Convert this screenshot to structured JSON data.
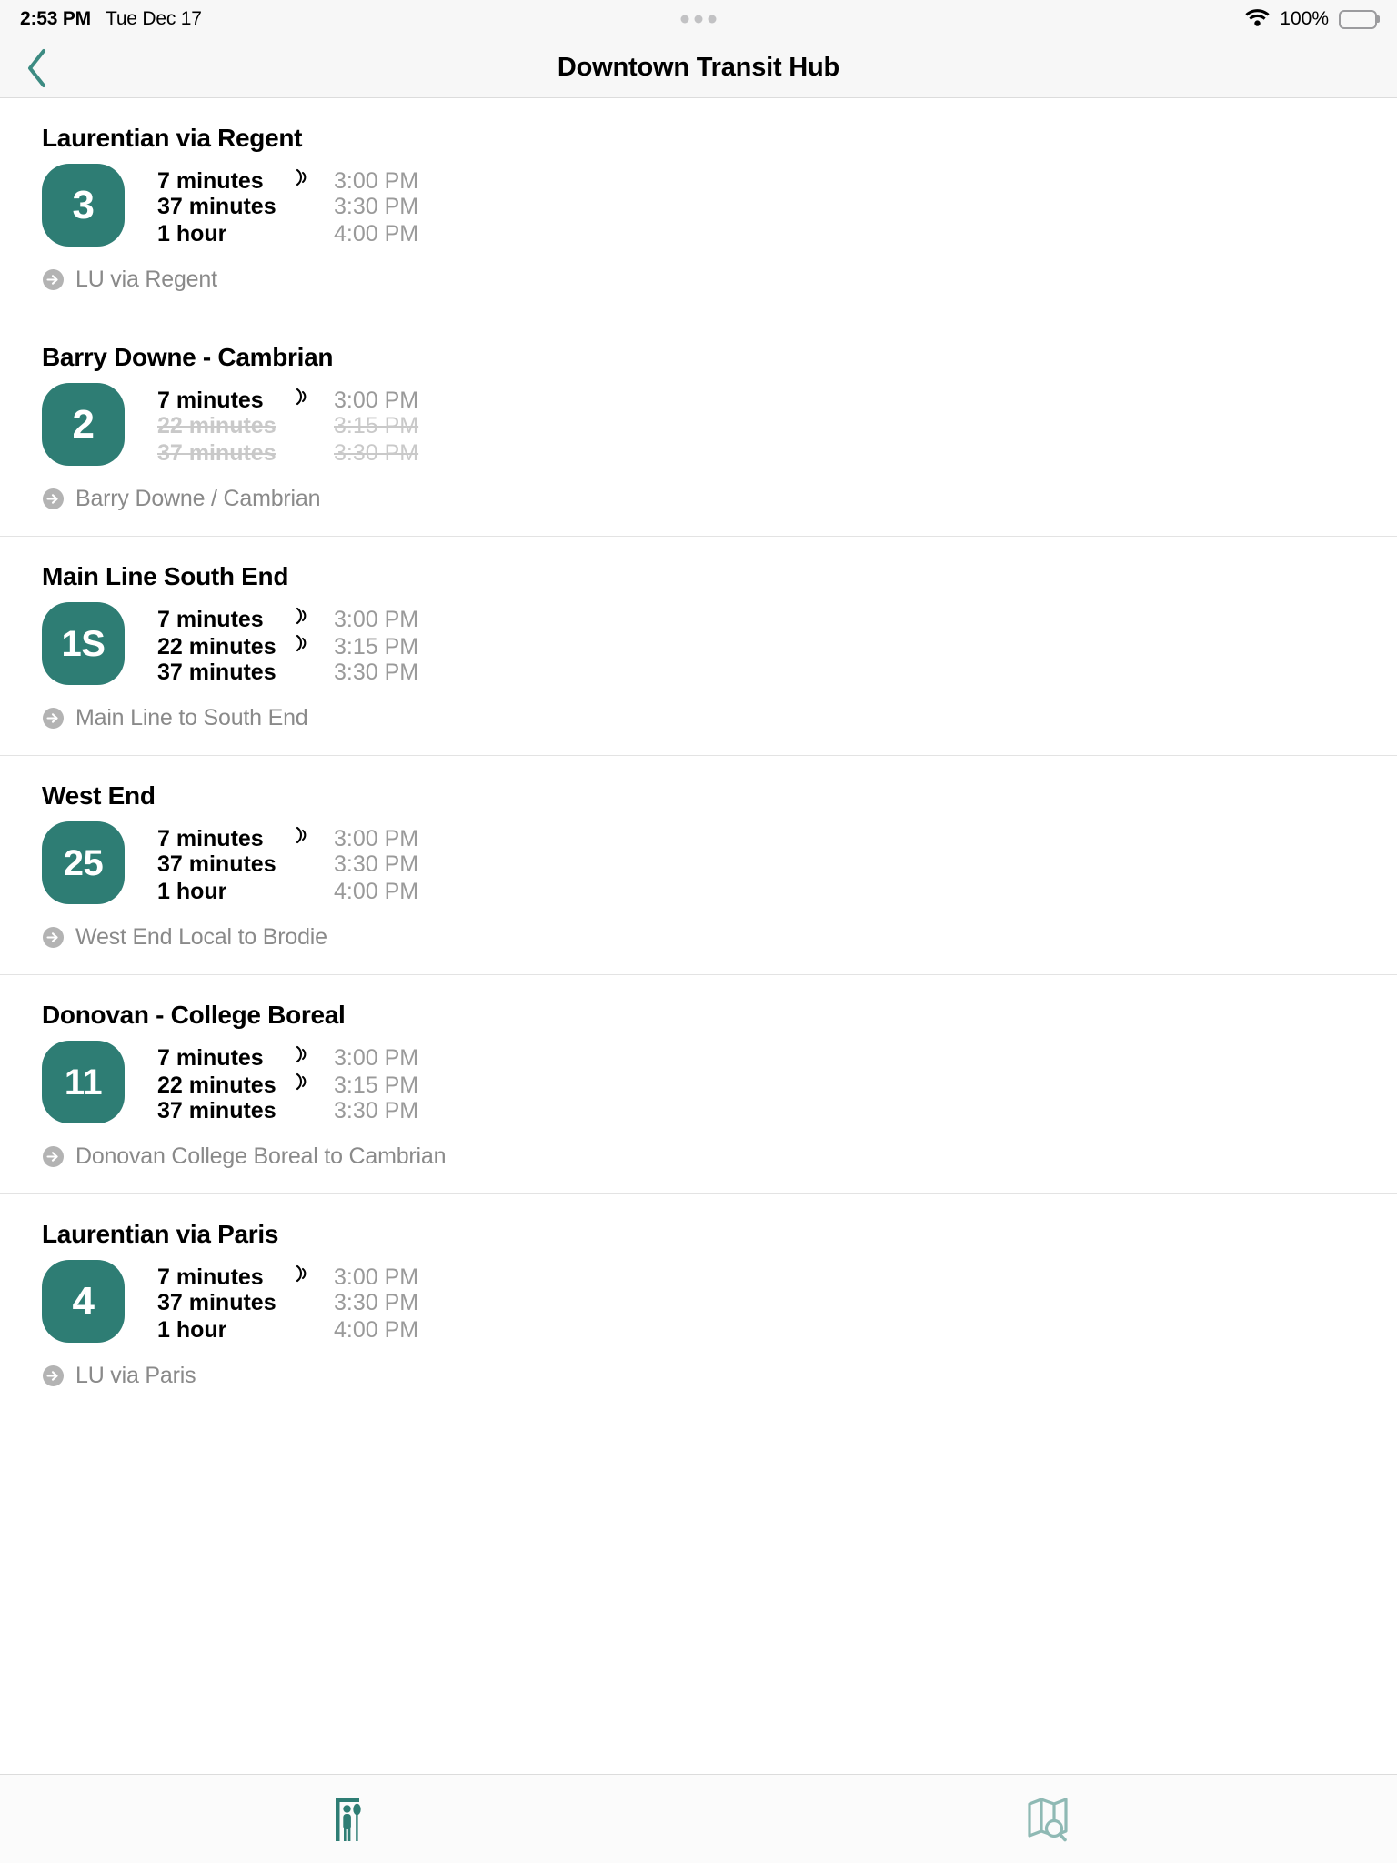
{
  "statusbar": {
    "time": "2:53 PM",
    "date": "Tue Dec 17",
    "battery_percent": "100%",
    "wifi_icon": "wifi-icon",
    "battery_icon": "battery-full-icon",
    "center_indicator": "three-dots-indicator"
  },
  "navbar": {
    "title": "Downtown Transit Hub",
    "back_icon": "chevron-left-icon"
  },
  "theme": {
    "accent": "#2e7d74",
    "accent_inactive": "#8fb9b4",
    "muted_text": "#9a9a9a",
    "cancelled_text": "#c9c9c9",
    "divider": "#e3e3e3",
    "chrome_bg": "#f7f7f7"
  },
  "routes": [
    {
      "name": "Laurentian via Regent",
      "badge": "3",
      "destination": "LU via Regent",
      "destination_icon": "arrow-right-circle-icon",
      "departures": [
        {
          "minutes": "7 minutes",
          "clock": "3:00 PM",
          "live": true,
          "cancelled": false
        },
        {
          "minutes": "37 minutes",
          "clock": "3:30 PM",
          "live": false,
          "cancelled": false
        },
        {
          "minutes": "1 hour",
          "clock": "4:00 PM",
          "live": false,
          "cancelled": false
        }
      ]
    },
    {
      "name": "Barry Downe - Cambrian",
      "badge": "2",
      "destination": "Barry Downe / Cambrian",
      "destination_icon": "arrow-right-circle-icon",
      "departures": [
        {
          "minutes": "7 minutes",
          "clock": "3:00 PM",
          "live": true,
          "cancelled": false
        },
        {
          "minutes": "22 minutes",
          "clock": "3:15 PM",
          "live": false,
          "cancelled": true
        },
        {
          "minutes": "37 minutes",
          "clock": "3:30 PM",
          "live": false,
          "cancelled": true
        }
      ]
    },
    {
      "name": "Main Line South End",
      "badge": "1S",
      "destination": "Main Line to South End",
      "destination_icon": "arrow-right-circle-icon",
      "departures": [
        {
          "minutes": "7 minutes",
          "clock": "3:00 PM",
          "live": true,
          "cancelled": false
        },
        {
          "minutes": "22 minutes",
          "clock": "3:15 PM",
          "live": true,
          "cancelled": false
        },
        {
          "minutes": "37 minutes",
          "clock": "3:30 PM",
          "live": false,
          "cancelled": false
        }
      ]
    },
    {
      "name": "West End",
      "badge": "25",
      "destination": "West End Local to Brodie",
      "destination_icon": "arrow-right-circle-icon",
      "departures": [
        {
          "minutes": "7 minutes",
          "clock": "3:00 PM",
          "live": true,
          "cancelled": false
        },
        {
          "minutes": "37 minutes",
          "clock": "3:30 PM",
          "live": false,
          "cancelled": false
        },
        {
          "minutes": "1 hour",
          "clock": "4:00 PM",
          "live": false,
          "cancelled": false
        }
      ]
    },
    {
      "name": "Donovan - College Boreal",
      "badge": "11",
      "destination": "Donovan College Boreal to Cambrian",
      "destination_icon": "arrow-right-circle-icon",
      "departures": [
        {
          "minutes": "7 minutes",
          "clock": "3:00 PM",
          "live": true,
          "cancelled": false
        },
        {
          "minutes": "22 minutes",
          "clock": "3:15 PM",
          "live": true,
          "cancelled": false
        },
        {
          "minutes": "37 minutes",
          "clock": "3:30 PM",
          "live": false,
          "cancelled": false
        }
      ]
    },
    {
      "name": "Laurentian via Paris",
      "badge": "4",
      "destination": "LU via Paris",
      "destination_icon": "arrow-right-circle-icon",
      "departures": [
        {
          "minutes": "7 minutes",
          "clock": "3:00 PM",
          "live": true,
          "cancelled": false
        },
        {
          "minutes": "37 minutes",
          "clock": "3:30 PM",
          "live": false,
          "cancelled": false
        },
        {
          "minutes": "1 hour",
          "clock": "4:00 PM",
          "live": false,
          "cancelled": false
        }
      ]
    }
  ],
  "tabbar": {
    "tabs": [
      {
        "icon": "bus-stop-icon",
        "active": true
      },
      {
        "icon": "map-search-icon",
        "active": false
      }
    ]
  }
}
